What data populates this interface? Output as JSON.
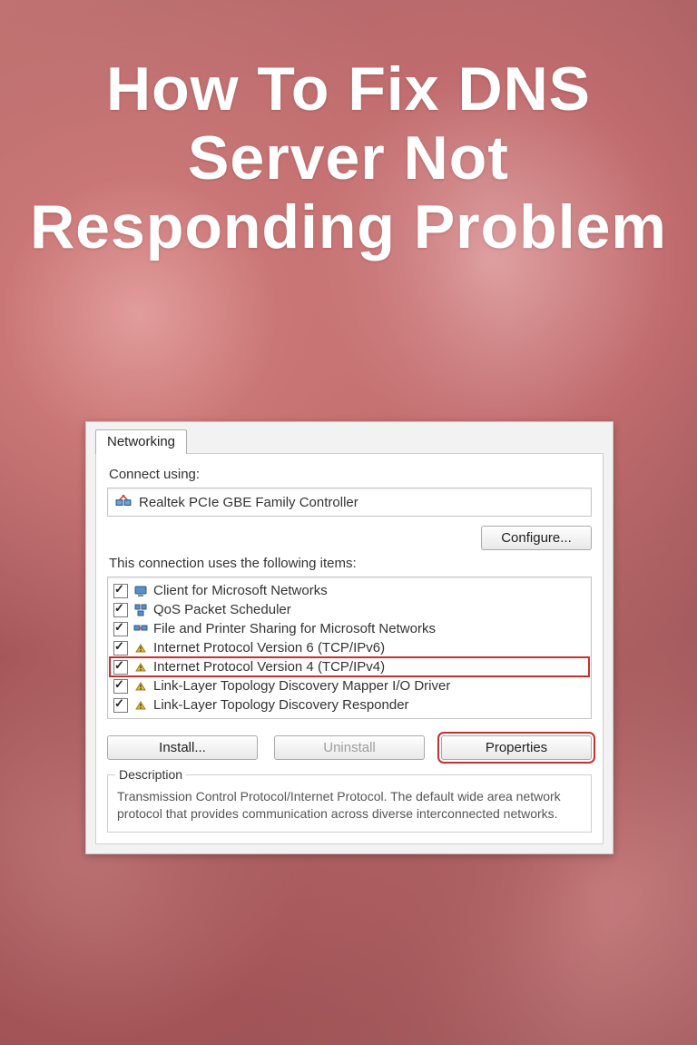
{
  "title": "How To Fix DNS Server Not Responding Problem",
  "dialog": {
    "tab": "Networking",
    "connect_label": "Connect using:",
    "adapter": "Realtek PCIe GBE Family Controller",
    "configure": "Configure...",
    "items_label": "This connection uses the following items:",
    "items": [
      {
        "label": "Client for Microsoft Networks",
        "icon": "client"
      },
      {
        "label": "QoS Packet Scheduler",
        "icon": "qos"
      },
      {
        "label": "File and Printer Sharing for Microsoft Networks",
        "icon": "share"
      },
      {
        "label": "Internet Protocol Version 6 (TCP/IPv6)",
        "icon": "proto"
      },
      {
        "label": "Internet Protocol Version 4 (TCP/IPv4)",
        "icon": "proto",
        "highlight": true
      },
      {
        "label": "Link-Layer Topology Discovery Mapper I/O Driver",
        "icon": "proto"
      },
      {
        "label": "Link-Layer Topology Discovery Responder",
        "icon": "proto"
      }
    ],
    "install": "Install...",
    "uninstall": "Uninstall",
    "properties": "Properties",
    "desc_legend": "Description",
    "desc": "Transmission Control Protocol/Internet Protocol. The default wide area network protocol that provides communication across diverse interconnected networks."
  }
}
